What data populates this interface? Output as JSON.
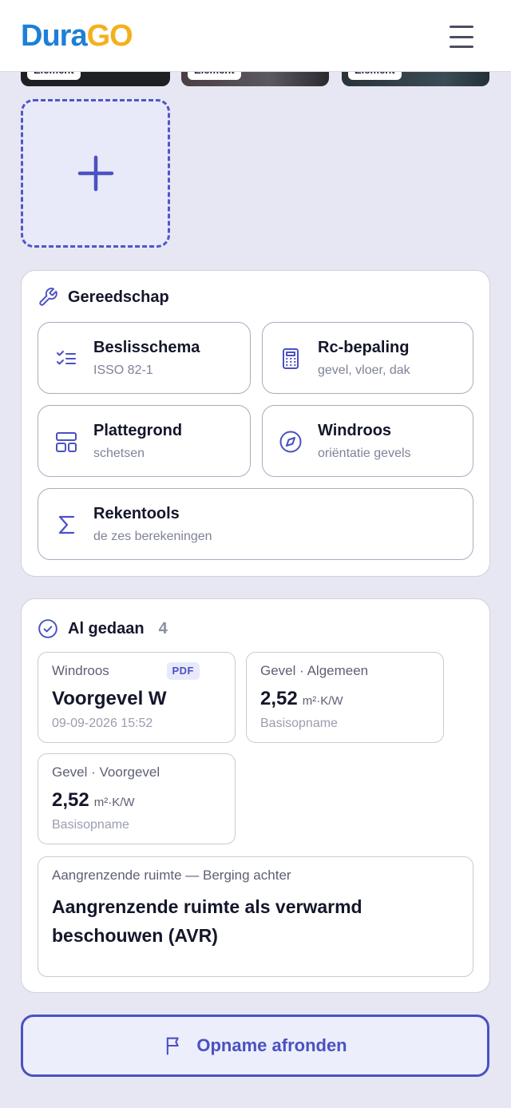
{
  "app": {
    "logo_part1": "Dura",
    "logo_part2": "GO"
  },
  "header": {
    "menu_icon": "hamburger-icon"
  },
  "photos": {
    "tag_label": "Element",
    "add_icon": "plus-icon"
  },
  "tools": {
    "title": "Gereedschap",
    "title_icon": "wrench-icon",
    "items": [
      {
        "name": "Beslisschema",
        "sub": "ISSO 82-1",
        "icon": "checklist-icon"
      },
      {
        "name": "Rc-bepaling",
        "sub": "gevel, vloer, dak",
        "icon": "calculator-icon"
      },
      {
        "name": "Plattegrond",
        "sub": "schetsen",
        "icon": "layout-icon"
      },
      {
        "name": "Windroos",
        "sub": "oriëntatie gevels",
        "icon": "compass-icon"
      },
      {
        "name": "Rekentools",
        "sub": "de zes berekeningen",
        "icon": "sigma-icon"
      }
    ]
  },
  "done": {
    "title": "Al gedaan",
    "count": "4",
    "title_icon": "check-circle-icon",
    "items": [
      {
        "category": "Windroos",
        "badge": "PDF",
        "value": "Voorgevel W",
        "sub": "09-09-2026 15:52"
      },
      {
        "category": "Gevel · Algemeen",
        "value": "2,52",
        "unit": "m²·K/W",
        "sub": "Basisopname"
      },
      {
        "category": "Gevel · Voorgevel",
        "value": "2,52",
        "unit": "m²·K/W",
        "sub": "Basisopname"
      },
      {
        "category": "Aangrenzende ruimte — Berging achter",
        "value": "Aangrenzende ruimte als verwarmd beschouwen (AVR)"
      }
    ]
  },
  "finish": {
    "label": "Opname afronden",
    "icon": "flag-icon"
  },
  "colors": {
    "accent": "#4a51c1",
    "logo_blue": "#1e7fd6",
    "logo_yellow": "#f4b01c"
  }
}
